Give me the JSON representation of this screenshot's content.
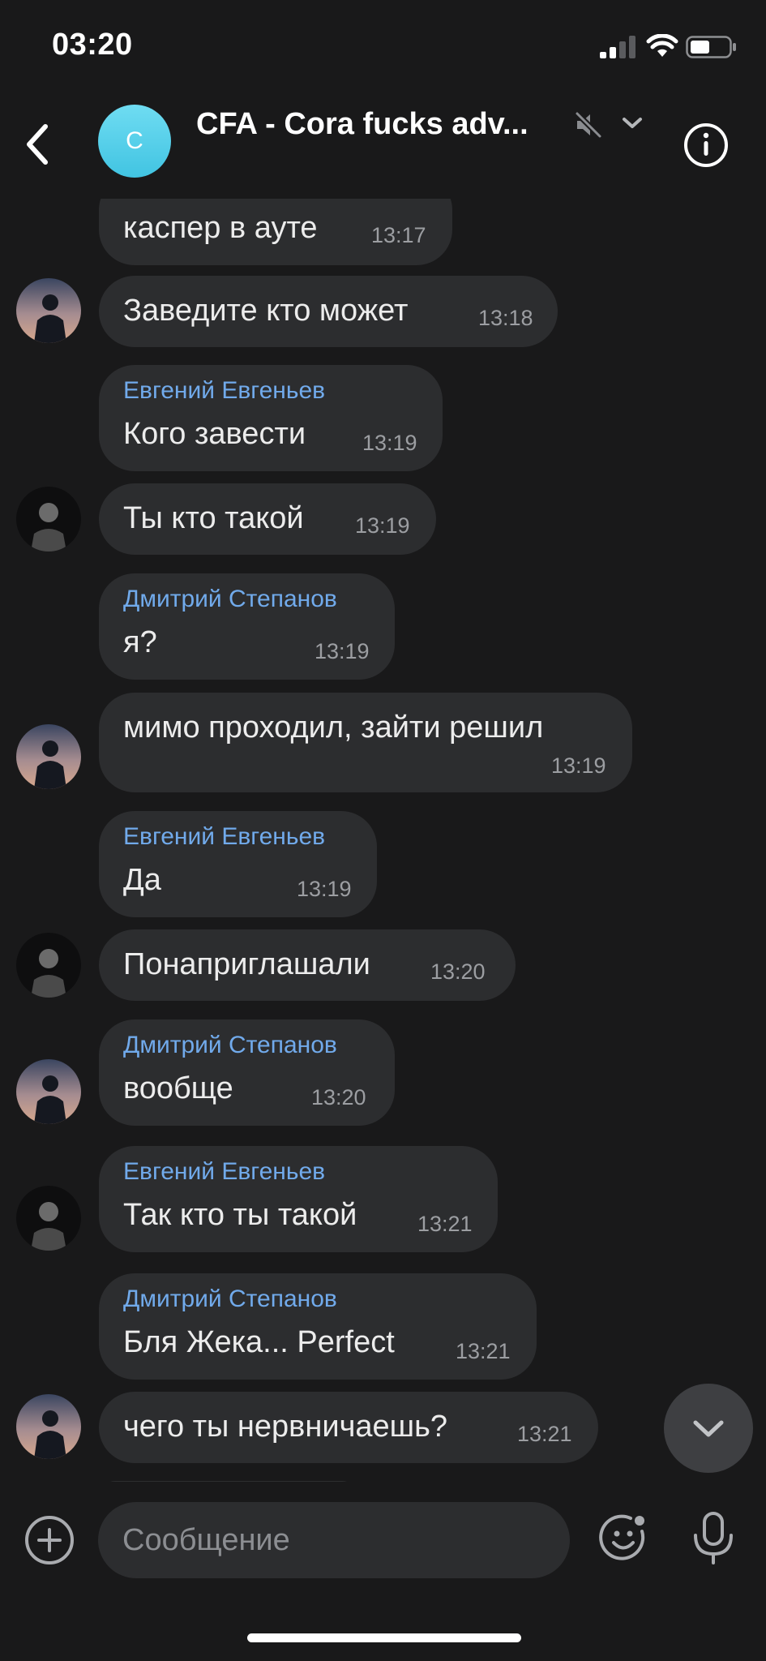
{
  "status_bar": {
    "time": "03:20"
  },
  "header": {
    "avatar_letter": "C",
    "title": "CFA - Cora fucks adv..."
  },
  "messages": [
    {
      "id": 0,
      "type": "other",
      "sender": "",
      "text": "каспер в ауте",
      "time": "13:17",
      "avatar": ""
    },
    {
      "id": 1,
      "type": "other",
      "sender": "",
      "text": "Заведите кто может",
      "time": "13:18",
      "avatar": "dmitriy"
    },
    {
      "id": 2,
      "type": "other",
      "sender": "Евгений Евгеньев",
      "text": "Кого завести",
      "time": "13:19",
      "avatar": ""
    },
    {
      "id": 3,
      "type": "other",
      "sender": "",
      "text": "Ты кто такой",
      "time": "13:19",
      "avatar": "evgeniy"
    },
    {
      "id": 4,
      "type": "other",
      "sender": "Дмитрий Степанов",
      "text": "я?",
      "time": "13:19",
      "avatar": ""
    },
    {
      "id": 5,
      "type": "other",
      "sender": "",
      "text": "мимо проходил, зайти решил",
      "time": "13:19",
      "avatar": "dmitriy"
    },
    {
      "id": 6,
      "type": "other",
      "sender": "Евгений Евгеньев",
      "text": "Да",
      "time": "13:19",
      "avatar": ""
    },
    {
      "id": 7,
      "type": "other",
      "sender": "",
      "text": "Понаприглашали",
      "time": "13:20",
      "avatar": "evgeniy"
    },
    {
      "id": 8,
      "type": "other",
      "sender": "Дмитрий Степанов",
      "text": "вообще",
      "time": "13:20",
      "avatar": "dmitriy"
    },
    {
      "id": 9,
      "type": "other",
      "sender": "Евгений Евгеньев",
      "text": "Так кто ты такой",
      "time": "13:21",
      "avatar": "evgeniy"
    },
    {
      "id": 10,
      "type": "other",
      "sender": "Дмитрий Степанов",
      "text": "Бля Жека... Perfect",
      "time": "13:21",
      "avatar": ""
    },
    {
      "id": 11,
      "type": "other",
      "sender": "",
      "text": "чего ты нервничаешь?",
      "time": "13:21",
      "avatar": "dmitriy"
    }
  ],
  "composer": {
    "placeholder": "Сообщение"
  },
  "colors": {
    "background": "#19191a",
    "bubble": "#2c2d2f",
    "sender": "#71aaeb",
    "avatar_chat": "#4cc9e6"
  },
  "icons": {
    "back": "chevron-left-icon",
    "mute": "speaker-muted-icon",
    "title_chevron": "chevron-down-icon",
    "info": "info-icon",
    "scroll": "chevron-down-icon",
    "attach": "plus-circle-icon",
    "emoji": "smile-icon",
    "mic": "microphone-icon"
  }
}
